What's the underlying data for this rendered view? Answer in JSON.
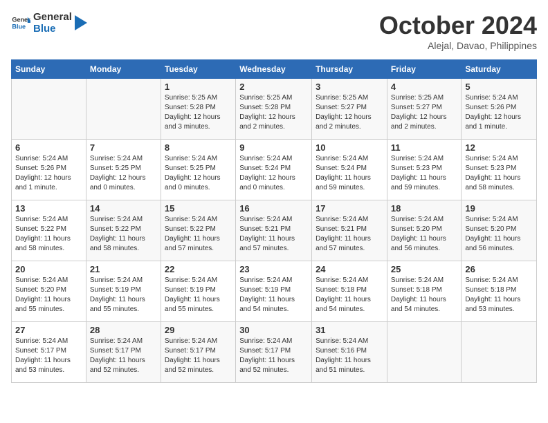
{
  "logo": {
    "text_general": "General",
    "text_blue": "Blue"
  },
  "title": "October 2024",
  "location": "Alejal, Davao, Philippines",
  "weekdays": [
    "Sunday",
    "Monday",
    "Tuesday",
    "Wednesday",
    "Thursday",
    "Friday",
    "Saturday"
  ],
  "weeks": [
    [
      {
        "day": "",
        "sunrise": "",
        "sunset": "",
        "daylight": ""
      },
      {
        "day": "",
        "sunrise": "",
        "sunset": "",
        "daylight": ""
      },
      {
        "day": "1",
        "sunrise": "Sunrise: 5:25 AM",
        "sunset": "Sunset: 5:28 PM",
        "daylight": "Daylight: 12 hours and 3 minutes."
      },
      {
        "day": "2",
        "sunrise": "Sunrise: 5:25 AM",
        "sunset": "Sunset: 5:28 PM",
        "daylight": "Daylight: 12 hours and 2 minutes."
      },
      {
        "day": "3",
        "sunrise": "Sunrise: 5:25 AM",
        "sunset": "Sunset: 5:27 PM",
        "daylight": "Daylight: 12 hours and 2 minutes."
      },
      {
        "day": "4",
        "sunrise": "Sunrise: 5:25 AM",
        "sunset": "Sunset: 5:27 PM",
        "daylight": "Daylight: 12 hours and 2 minutes."
      },
      {
        "day": "5",
        "sunrise": "Sunrise: 5:24 AM",
        "sunset": "Sunset: 5:26 PM",
        "daylight": "Daylight: 12 hours and 1 minute."
      }
    ],
    [
      {
        "day": "6",
        "sunrise": "Sunrise: 5:24 AM",
        "sunset": "Sunset: 5:26 PM",
        "daylight": "Daylight: 12 hours and 1 minute."
      },
      {
        "day": "7",
        "sunrise": "Sunrise: 5:24 AM",
        "sunset": "Sunset: 5:25 PM",
        "daylight": "Daylight: 12 hours and 0 minutes."
      },
      {
        "day": "8",
        "sunrise": "Sunrise: 5:24 AM",
        "sunset": "Sunset: 5:25 PM",
        "daylight": "Daylight: 12 hours and 0 minutes."
      },
      {
        "day": "9",
        "sunrise": "Sunrise: 5:24 AM",
        "sunset": "Sunset: 5:24 PM",
        "daylight": "Daylight: 12 hours and 0 minutes."
      },
      {
        "day": "10",
        "sunrise": "Sunrise: 5:24 AM",
        "sunset": "Sunset: 5:24 PM",
        "daylight": "Daylight: 11 hours and 59 minutes."
      },
      {
        "day": "11",
        "sunrise": "Sunrise: 5:24 AM",
        "sunset": "Sunset: 5:23 PM",
        "daylight": "Daylight: 11 hours and 59 minutes."
      },
      {
        "day": "12",
        "sunrise": "Sunrise: 5:24 AM",
        "sunset": "Sunset: 5:23 PM",
        "daylight": "Daylight: 11 hours and 58 minutes."
      }
    ],
    [
      {
        "day": "13",
        "sunrise": "Sunrise: 5:24 AM",
        "sunset": "Sunset: 5:22 PM",
        "daylight": "Daylight: 11 hours and 58 minutes."
      },
      {
        "day": "14",
        "sunrise": "Sunrise: 5:24 AM",
        "sunset": "Sunset: 5:22 PM",
        "daylight": "Daylight: 11 hours and 58 minutes."
      },
      {
        "day": "15",
        "sunrise": "Sunrise: 5:24 AM",
        "sunset": "Sunset: 5:22 PM",
        "daylight": "Daylight: 11 hours and 57 minutes."
      },
      {
        "day": "16",
        "sunrise": "Sunrise: 5:24 AM",
        "sunset": "Sunset: 5:21 PM",
        "daylight": "Daylight: 11 hours and 57 minutes."
      },
      {
        "day": "17",
        "sunrise": "Sunrise: 5:24 AM",
        "sunset": "Sunset: 5:21 PM",
        "daylight": "Daylight: 11 hours and 57 minutes."
      },
      {
        "day": "18",
        "sunrise": "Sunrise: 5:24 AM",
        "sunset": "Sunset: 5:20 PM",
        "daylight": "Daylight: 11 hours and 56 minutes."
      },
      {
        "day": "19",
        "sunrise": "Sunrise: 5:24 AM",
        "sunset": "Sunset: 5:20 PM",
        "daylight": "Daylight: 11 hours and 56 minutes."
      }
    ],
    [
      {
        "day": "20",
        "sunrise": "Sunrise: 5:24 AM",
        "sunset": "Sunset: 5:20 PM",
        "daylight": "Daylight: 11 hours and 55 minutes."
      },
      {
        "day": "21",
        "sunrise": "Sunrise: 5:24 AM",
        "sunset": "Sunset: 5:19 PM",
        "daylight": "Daylight: 11 hours and 55 minutes."
      },
      {
        "day": "22",
        "sunrise": "Sunrise: 5:24 AM",
        "sunset": "Sunset: 5:19 PM",
        "daylight": "Daylight: 11 hours and 55 minutes."
      },
      {
        "day": "23",
        "sunrise": "Sunrise: 5:24 AM",
        "sunset": "Sunset: 5:19 PM",
        "daylight": "Daylight: 11 hours and 54 minutes."
      },
      {
        "day": "24",
        "sunrise": "Sunrise: 5:24 AM",
        "sunset": "Sunset: 5:18 PM",
        "daylight": "Daylight: 11 hours and 54 minutes."
      },
      {
        "day": "25",
        "sunrise": "Sunrise: 5:24 AM",
        "sunset": "Sunset: 5:18 PM",
        "daylight": "Daylight: 11 hours and 54 minutes."
      },
      {
        "day": "26",
        "sunrise": "Sunrise: 5:24 AM",
        "sunset": "Sunset: 5:18 PM",
        "daylight": "Daylight: 11 hours and 53 minutes."
      }
    ],
    [
      {
        "day": "27",
        "sunrise": "Sunrise: 5:24 AM",
        "sunset": "Sunset: 5:17 PM",
        "daylight": "Daylight: 11 hours and 53 minutes."
      },
      {
        "day": "28",
        "sunrise": "Sunrise: 5:24 AM",
        "sunset": "Sunset: 5:17 PM",
        "daylight": "Daylight: 11 hours and 52 minutes."
      },
      {
        "day": "29",
        "sunrise": "Sunrise: 5:24 AM",
        "sunset": "Sunset: 5:17 PM",
        "daylight": "Daylight: 11 hours and 52 minutes."
      },
      {
        "day": "30",
        "sunrise": "Sunrise: 5:24 AM",
        "sunset": "Sunset: 5:17 PM",
        "daylight": "Daylight: 11 hours and 52 minutes."
      },
      {
        "day": "31",
        "sunrise": "Sunrise: 5:24 AM",
        "sunset": "Sunset: 5:16 PM",
        "daylight": "Daylight: 11 hours and 51 minutes."
      },
      {
        "day": "",
        "sunrise": "",
        "sunset": "",
        "daylight": ""
      },
      {
        "day": "",
        "sunrise": "",
        "sunset": "",
        "daylight": ""
      }
    ]
  ]
}
